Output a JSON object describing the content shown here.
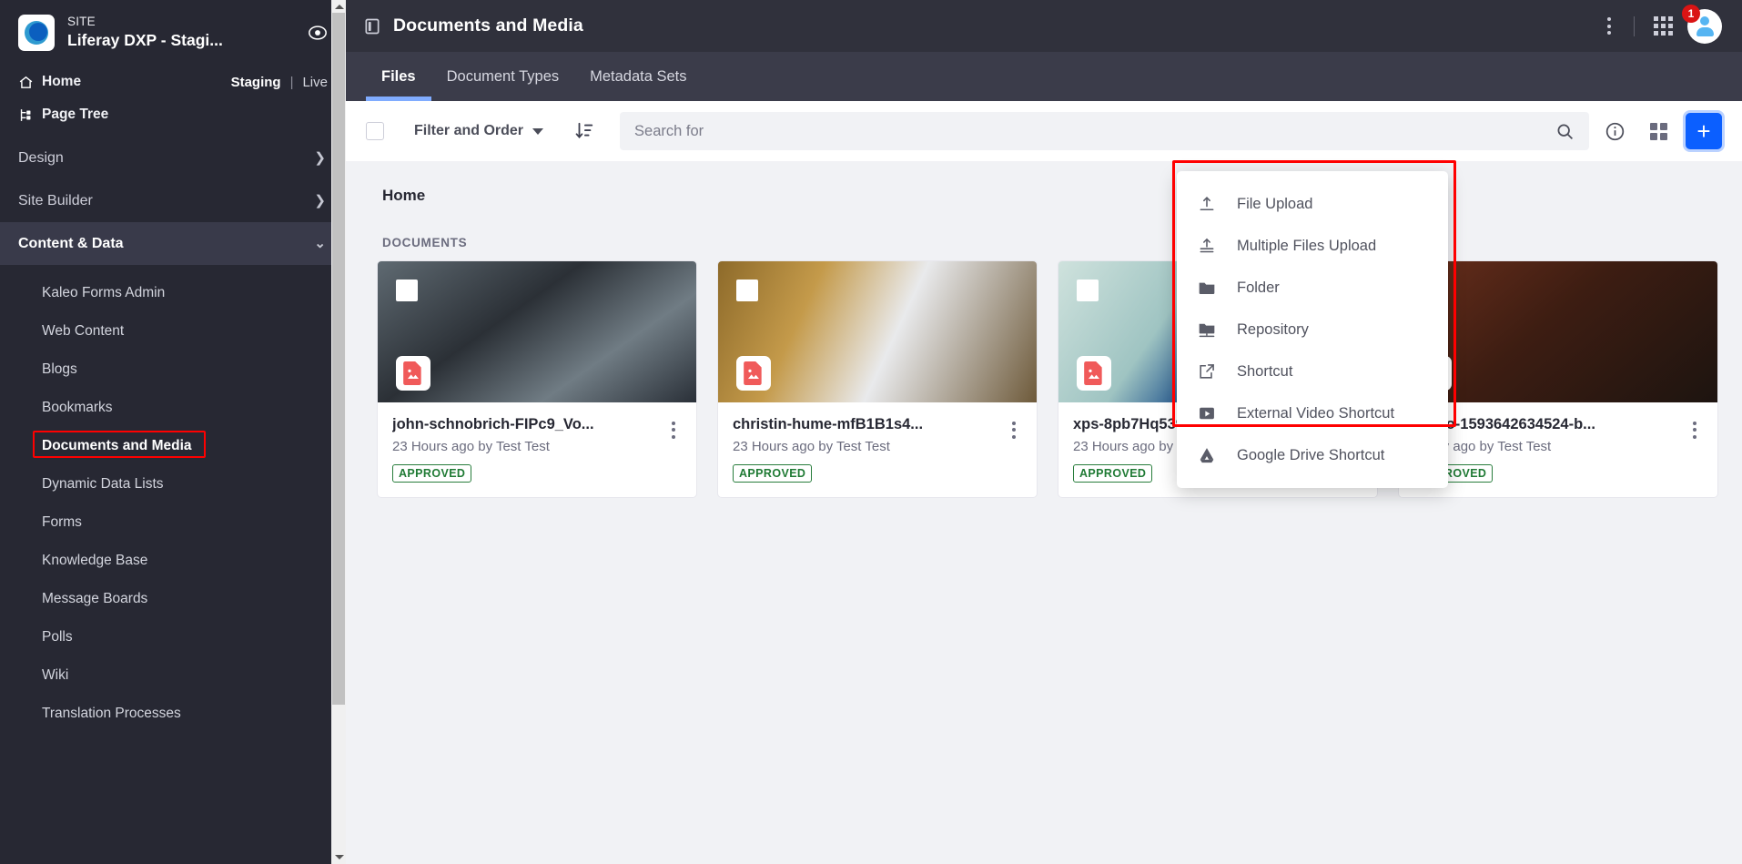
{
  "sidebar": {
    "site_label": "SITE",
    "site_title": "Liferay DXP - Stagi...",
    "compass_icon": "compass-icon",
    "quick_links": [
      {
        "label": "Home",
        "icon": "home-icon"
      },
      {
        "label": "Page Tree",
        "icon": "page-tree-icon"
      }
    ],
    "staging_label": "Staging",
    "separator": "|",
    "live_label": "Live",
    "sections": [
      {
        "label": "Design",
        "expanded": false,
        "chevron": "chevron-right-icon"
      },
      {
        "label": "Site Builder",
        "expanded": false,
        "chevron": "chevron-right-icon"
      },
      {
        "label": "Content & Data",
        "expanded": true,
        "chevron": "chevron-down-icon"
      }
    ],
    "content_data_items": [
      "Kaleo Forms Admin",
      "Web Content",
      "Blogs",
      "Bookmarks",
      "Documents and Media",
      "Dynamic Data Lists",
      "Forms",
      "Knowledge Base",
      "Message Boards",
      "Polls",
      "Wiki",
      "Translation Processes"
    ],
    "highlighted_item": "Documents and Media",
    "highlight_color": "#ff0000"
  },
  "topbar": {
    "product_icon": "documents-panel-icon",
    "title": "Documents and Media",
    "kebab_icon": "kebab-vertical-icon",
    "grid_icon": "app-grid-icon",
    "avatar_icon": "user-avatar-icon",
    "notification_count": "1",
    "notification_color": "#da1414"
  },
  "tabs": [
    {
      "label": "Files",
      "active": true
    },
    {
      "label": "Document Types",
      "active": false
    },
    {
      "label": "Metadata Sets",
      "active": false
    }
  ],
  "toolbar": {
    "select_all_checkbox": "",
    "filter_label": "Filter and Order",
    "caret_icon": "chevron-down-icon",
    "sort_icon": "sort-descending-icon",
    "search_placeholder": "Search for",
    "search_value": "",
    "search_icon": "search-icon",
    "info_icon": "info-circle-icon",
    "display_style_icon": "cards-view-icon",
    "add_icon": "plus-icon",
    "add_button_color": "#0b5fff"
  },
  "content": {
    "breadcrumb": "Home",
    "section_title": "DOCUMENTS",
    "cards": [
      {
        "title": "john-schnobrich-FIPc9_Vo...",
        "meta": "23 Hours ago by Test Test",
        "status": "APPROVED",
        "type_icon": "image-file-icon",
        "kebab_icon": "kebab-vertical-icon"
      },
      {
        "title": "christin-hume-mfB1B1s4...",
        "meta": "23 Hours ago by Test Test",
        "status": "APPROVED",
        "type_icon": "image-file-icon",
        "kebab_icon": "kebab-vertical-icon"
      },
      {
        "title": "xps-8pb7Hq539Zw-unspl...",
        "meta": "23 Hours ago by Test Test",
        "status": "APPROVED",
        "type_icon": "image-file-icon",
        "kebab_icon": "kebab-vertical-icon"
      },
      {
        "title": "photo-1593642634524-b...",
        "meta": "1 Day ago by Test Test",
        "status": "APPROVED",
        "type_icon": "image-file-icon",
        "kebab_icon": "kebab-vertical-icon"
      }
    ]
  },
  "add_menu": {
    "items": [
      {
        "label": "File Upload",
        "icon": "upload-file-icon"
      },
      {
        "label": "Multiple Files Upload",
        "icon": "upload-multiple-icon"
      },
      {
        "label": "Folder",
        "icon": "folder-icon"
      },
      {
        "label": "Repository",
        "icon": "repository-icon"
      },
      {
        "label": "Shortcut",
        "icon": "external-link-icon"
      },
      {
        "label": "External Video Shortcut",
        "icon": "video-play-icon"
      },
      {
        "label": "Google Drive Shortcut",
        "icon": "google-drive-icon"
      }
    ],
    "highlight_color": "#ff0000"
  }
}
